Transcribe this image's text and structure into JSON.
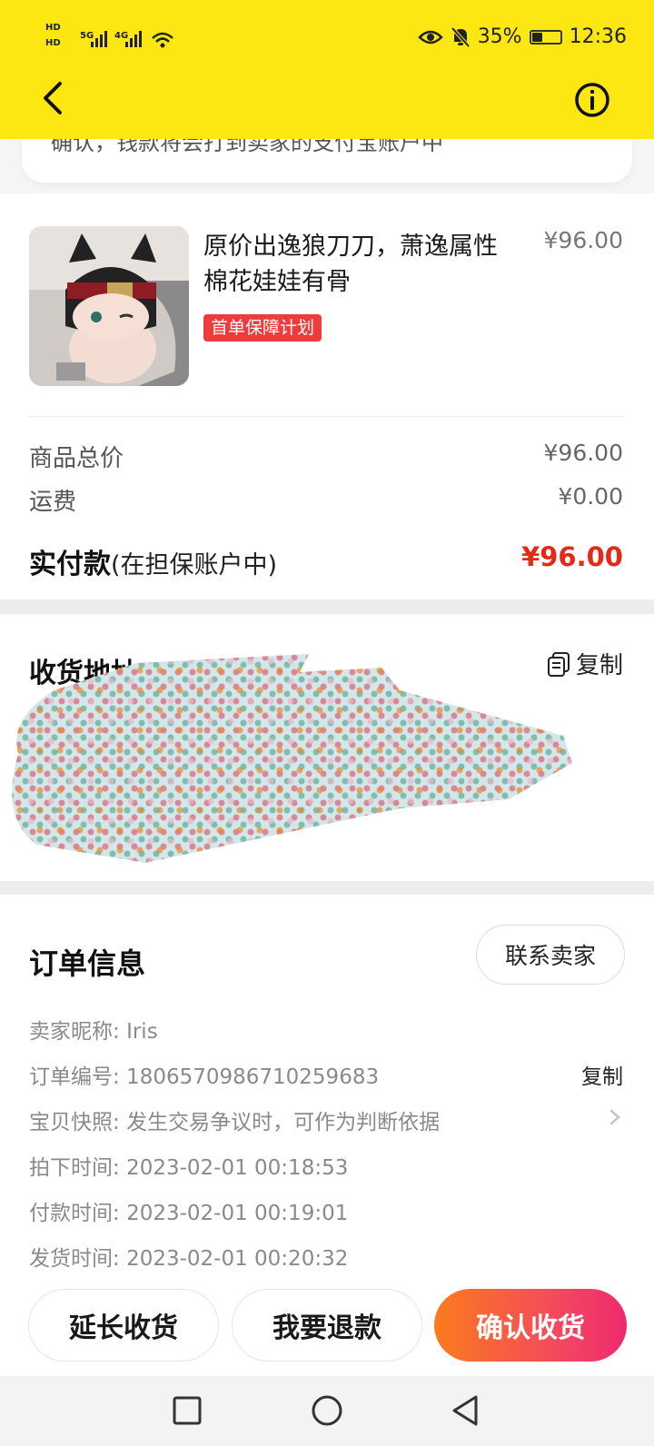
{
  "status_bar": {
    "hd1": "HD",
    "hd2": "HD",
    "net1": "5G",
    "net2": "4G",
    "battery": "35%",
    "time": "12:36",
    "icons": [
      "eye-icon",
      "bell-off-icon",
      "battery-icon",
      "wifi-icon",
      "signal-icon"
    ]
  },
  "header": {
    "back_icon": "chevron-left-icon",
    "info_icon": "info-circle-icon"
  },
  "top_card": {
    "partial_text": "确认，钱款将会打到卖家的支付宝账户中"
  },
  "product": {
    "title": "原价出逸狼刀刀，萧逸属性棉花娃娃有骨",
    "price": "¥96.00",
    "badge": "首单保障计划"
  },
  "summary": {
    "rows": [
      {
        "label": "商品总价",
        "value": "¥96.00"
      },
      {
        "label": "运费",
        "value": "¥0.00"
      }
    ],
    "pay_label": "实付款",
    "pay_sub": "(在担保账户中)",
    "pay_value": "¥96.00"
  },
  "address": {
    "title": "收货地址",
    "copy_label": "复制"
  },
  "order": {
    "title": "订单信息",
    "contact_label": "联系卖家",
    "rows": [
      {
        "label": "卖家昵称:",
        "value": "Iris"
      },
      {
        "label": "订单编号:",
        "value": "1806570986710259683"
      },
      {
        "label": "宝贝快照:",
        "value": "发生交易争议时，可作为判断依据"
      },
      {
        "label": "拍下时间:",
        "value": "2023-02-01 00:18:53"
      },
      {
        "label": "付款时间:",
        "value": "2023-02-01 00:19:01"
      },
      {
        "label": "发货时间:",
        "value": "2023-02-01 00:20:32"
      }
    ],
    "copy_label": "复制"
  },
  "actions": {
    "extend": "延长收货",
    "refund": "我要退款",
    "confirm": "确认收货"
  },
  "colors": {
    "header_bg": "#fde712",
    "price_red": "#e42a16",
    "badge_red": "#ef3b3b",
    "confirm_gradient_start": "#fb7b1d",
    "confirm_gradient_end": "#ee2a6e"
  },
  "nav_bar": {
    "icons": [
      "square-icon",
      "circle-icon",
      "triangle-back-icon"
    ]
  }
}
